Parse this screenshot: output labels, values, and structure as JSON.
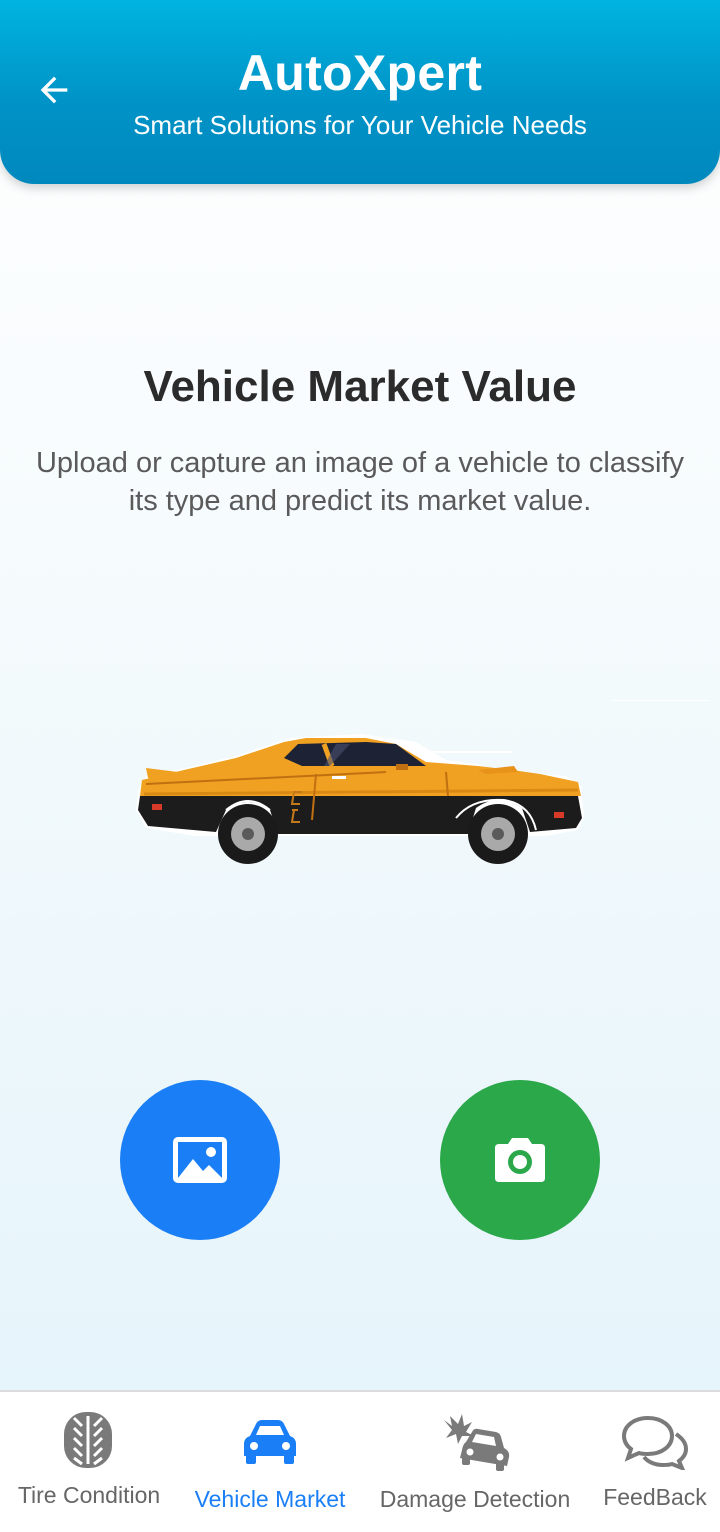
{
  "header": {
    "back_icon": "arrow-left-icon",
    "title": "AutoXpert",
    "subtitle": "Smart Solutions for Your Vehicle Needs",
    "colors": {
      "gradient_top": "#00b4e0",
      "gradient_bottom": "#0088bd"
    }
  },
  "main": {
    "title": "Vehicle Market Value",
    "description": "Upload or capture an image of a vehicle to classify its type and predict its market value.",
    "illustration": "muscle-car-illustration",
    "actions": {
      "gallery": {
        "icon": "image-icon",
        "color": "#1a7ff7"
      },
      "camera": {
        "icon": "camera-icon",
        "color": "#2aa84a"
      }
    }
  },
  "bottom_nav": {
    "active_color": "#1a7ff7",
    "items": [
      {
        "label": "Tire Condition",
        "icon": "tire-icon",
        "active": false
      },
      {
        "label": "Vehicle Market",
        "icon": "car-icon",
        "active": true
      },
      {
        "label": "Damage Detection",
        "icon": "car-crash-icon",
        "active": false
      },
      {
        "label": "FeedBack",
        "icon": "chat-bubbles-icon",
        "active": false
      }
    ]
  }
}
